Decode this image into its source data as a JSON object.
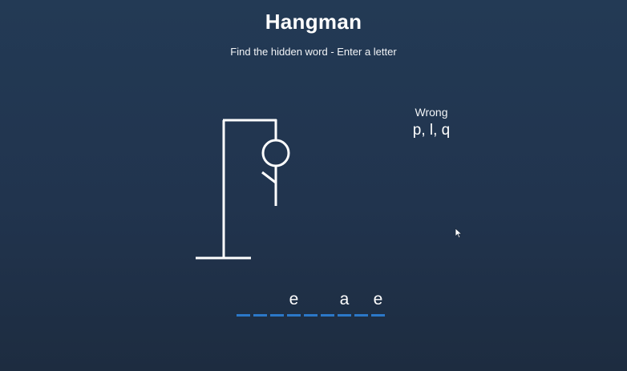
{
  "header": {
    "title": "Hangman",
    "subtitle": "Find the hidden word - Enter a letter"
  },
  "wrong": {
    "label": "Wrong",
    "letters": "p, l, q"
  },
  "word": {
    "length": 9,
    "slots": [
      "",
      "",
      "",
      "e",
      "",
      "",
      "a",
      "",
      "e"
    ]
  },
  "hangman": {
    "parts_shown": [
      "gallows",
      "head",
      "body",
      "left-arm"
    ]
  },
  "colors": {
    "background": "#21344e",
    "text": "#ffffff",
    "slot_underline": "#2b78c8",
    "figure_stroke": "#ffffff"
  }
}
